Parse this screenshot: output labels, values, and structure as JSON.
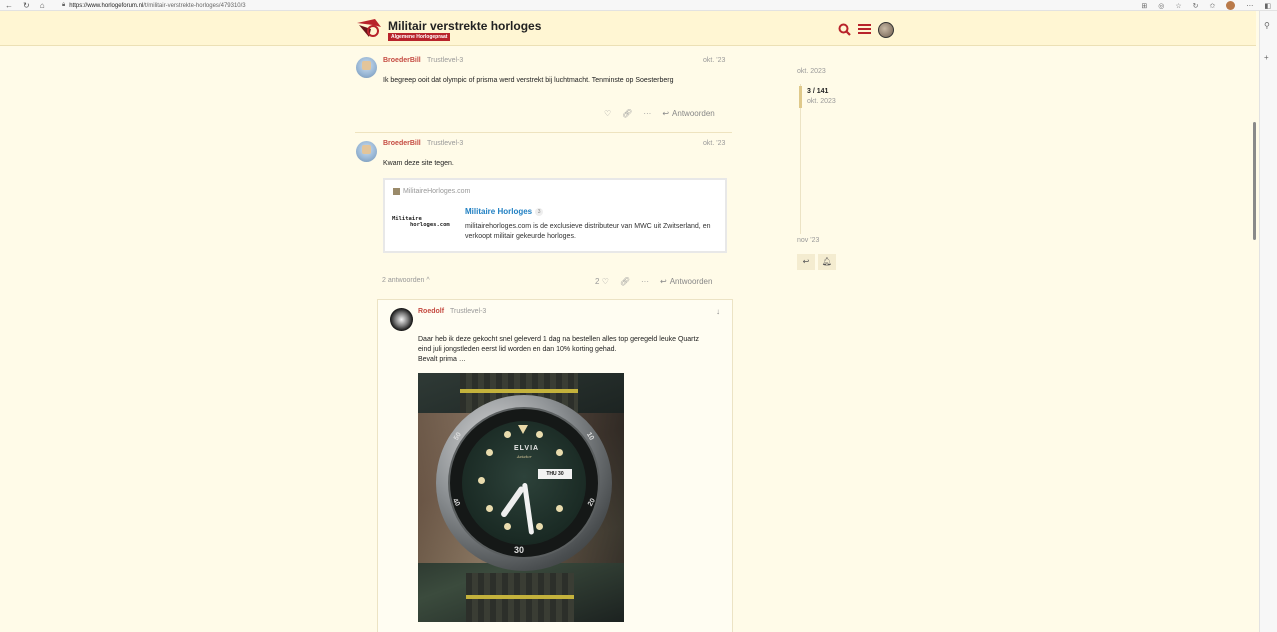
{
  "browser": {
    "url_host": "https://www.horlogeforum.nl",
    "url_path": "/t/militair-verstrekte-horloges/479310/3"
  },
  "header": {
    "site_title": "Militair verstrekte horloges",
    "category": "Algemene Horlogepraat"
  },
  "posts": [
    {
      "username": "BroederBill",
      "trust": "Trustlevel-3",
      "date": "okt. '23",
      "text": "Ik begreep ooit dat olympic of prisma werd verstrekt bij luchtmacht. Tenminste op Soesterberg",
      "reply_label": "Antwoorden",
      "like_count": ""
    },
    {
      "username": "BroederBill",
      "trust": "Trustlevel-3",
      "date": "okt. '23",
      "text": "Kwam deze site tegen.",
      "reply_label": "Antwoorden",
      "like_count": "2",
      "replies_toggle": "2 antwoorden",
      "onebox": {
        "source": "MilitaireHorloges.com",
        "logo_line1": "Militaire",
        "logo_line2": "horloges.com",
        "title": "Militaire Horloges",
        "click_count": "3",
        "description": "militairehorloges.com is de exclusieve distributeur van MWC uit Zwitserland, en verkoopt militair gekeurde horloges."
      }
    }
  ],
  "embedded_reply": {
    "username": "Roedolf",
    "trust": "Trustlevel-3",
    "text_line1": "Daar heb ik deze gekocht snel geleverd 1 dag na bestellen alles top geregeld leuke Quartz",
    "text_line2": "eind juli jongstleden eerst lid worden en dan 10% korting gehad.",
    "text_line3": "Bevalt prima …",
    "photo": {
      "brand": "ELVIA",
      "sub": "Aviator",
      "daydate": "THU 30",
      "bezel_30": "30",
      "bezel_20": "20",
      "bezel_40": "40",
      "bezel_10": "10",
      "bezel_50": "50"
    }
  },
  "timeline": {
    "start_date": "okt. 2023",
    "position": "3 / 141",
    "position_date": "okt. 2023",
    "end_date": "nov '23"
  }
}
